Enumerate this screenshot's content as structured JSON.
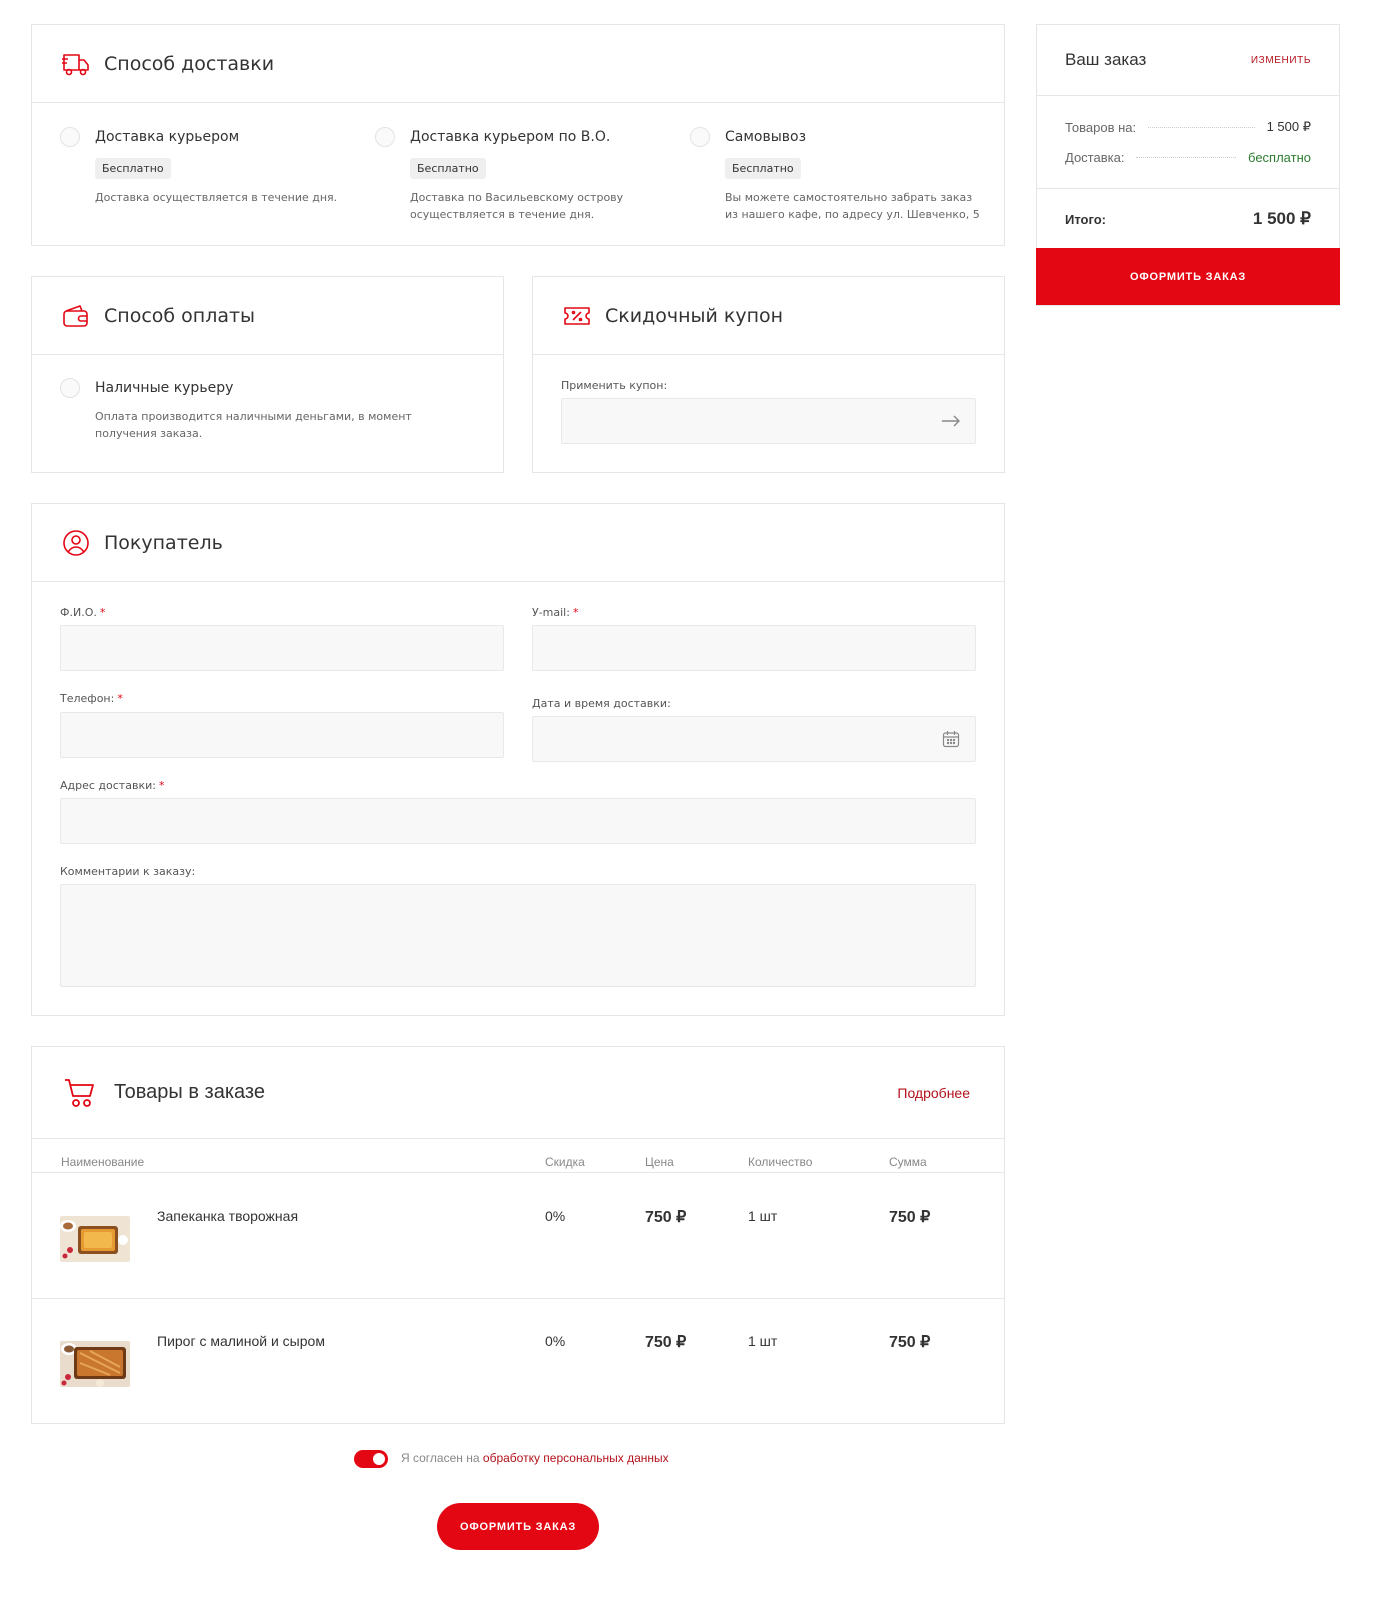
{
  "delivery": {
    "title": "Способ доставки",
    "options": [
      {
        "title": "Доставка курьером",
        "badge": "Бесплатно",
        "desc1": "Доставка осуществляется в течение дня.",
        "desc2": ""
      },
      {
        "title": "Доставка курьером по В.О.",
        "badge": "Бесплатно",
        "desc1": "Доставка по Васильевскому острову",
        "desc2": "осуществляется в течение дня."
      },
      {
        "title": "Самовывоз",
        "badge": "Бесплатно",
        "desc1": "Вы можете самостоятельно забрать заказ",
        "desc2": "из нашего кафе, по адресу ул. Шевченко, 5"
      }
    ]
  },
  "payment": {
    "title": "Способ оплаты",
    "option": {
      "title": "Наличные курьеру",
      "desc1": "Оплата производится наличными деньгами, в момент",
      "desc2": "получения заказа."
    }
  },
  "coupon": {
    "title": "Скидочный купон",
    "label": "Применить купон:",
    "value": ""
  },
  "buyer": {
    "title": "Покупатель",
    "fio_label": "Ф.И.О.",
    "email_label": "У-mail:",
    "phone_label": "Телефон:",
    "datetime_label": "Дата и время доставки:",
    "address_label": "Адрес доставки:",
    "comment_label": "Комментарии к заказу:",
    "required_mark": "*"
  },
  "goods": {
    "title": "Товары в заказе",
    "more_link": "Подробнее",
    "columns": [
      "Наименование",
      "Скидка",
      "Цена",
      "Количество",
      "Сумма"
    ],
    "rows": [
      {
        "name": "Запеканка творожная",
        "discount": "0%",
        "price": "750 ₽",
        "qty": "1 шт",
        "sum": "750 ₽"
      },
      {
        "name": "Пирог с малиной и сыром",
        "discount": "0%",
        "price": "750 ₽",
        "qty": "1 шт",
        "sum": "750 ₽"
      }
    ]
  },
  "consent": {
    "text": "Я согласен на",
    "link": "обработку персональных данных",
    "enabled": true
  },
  "submit_bottom": "ОФОРМИТЬ ЗАКАЗ",
  "summary": {
    "title": "Ваш заказ",
    "edit": "ИЗМЕНИТЬ",
    "goods_label": "Товаров на:",
    "goods_value": "1 500 ₽",
    "delivery_label": "Доставка:",
    "delivery_value": "бесплатно",
    "total_label": "Итого:",
    "total_value": "1 500 ₽",
    "submit": "ОФОРМИТЬ ЗАКАЗ"
  },
  "colors": {
    "accent": "#e30613",
    "link": "#b3121b",
    "green": "#2e7d32"
  }
}
